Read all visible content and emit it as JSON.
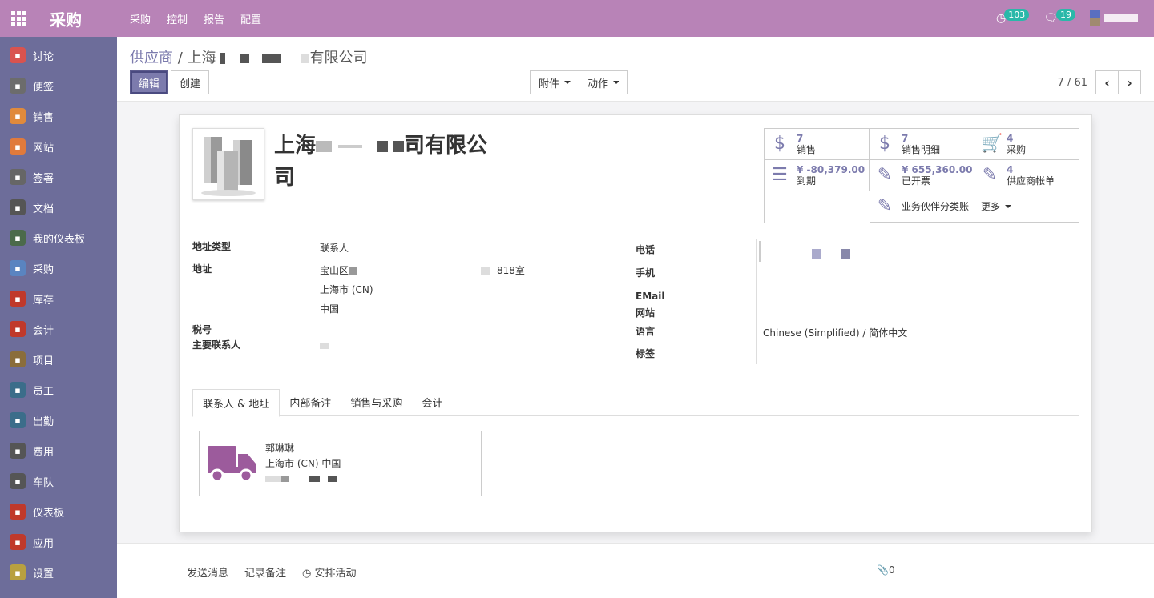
{
  "topbar": {
    "app_title": "采购",
    "menu": [
      "采购",
      "控制",
      "报告",
      "配置"
    ],
    "activity_count": "103",
    "message_count": "19"
  },
  "sidebar": {
    "items": [
      {
        "label": "讨论",
        "icon": "chat-icon",
        "color": "#d9534f"
      },
      {
        "label": "便签",
        "icon": "note-icon",
        "color": "#6c6c6c"
      },
      {
        "label": "销售",
        "icon": "chart-icon",
        "color": "#e08a3c"
      },
      {
        "label": "网站",
        "icon": "globe-icon",
        "color": "#e07a3c"
      },
      {
        "label": "签署",
        "icon": "sign-icon",
        "color": "#666666"
      },
      {
        "label": "文档",
        "icon": "document-icon",
        "color": "#555555"
      },
      {
        "label": "我的仪表板",
        "icon": "dashboard-icon",
        "color": "#4b6a4b"
      },
      {
        "label": "采购",
        "icon": "purchase-icon",
        "color": "#5a84c0"
      },
      {
        "label": "库存",
        "icon": "inventory-icon",
        "color": "#c0392b"
      },
      {
        "label": "会计",
        "icon": "accounting-icon",
        "color": "#c0392b"
      },
      {
        "label": "项目",
        "icon": "project-icon",
        "color": "#8a6d3b"
      },
      {
        "label": "员工",
        "icon": "employees-icon",
        "color": "#3b6d8a"
      },
      {
        "label": "出勤",
        "icon": "attendance-icon",
        "color": "#3b6d8a"
      },
      {
        "label": "费用",
        "icon": "expense-icon",
        "color": "#555555"
      },
      {
        "label": "车队",
        "icon": "fleet-icon",
        "color": "#555555"
      },
      {
        "label": "仪表板",
        "icon": "dashboards-icon",
        "color": "#c0392b"
      },
      {
        "label": "应用",
        "icon": "apps-icon",
        "color": "#c0392b"
      },
      {
        "label": "设置",
        "icon": "settings-icon",
        "color": "#b8a040"
      }
    ]
  },
  "breadcrumb": {
    "parent": "供应商",
    "separator": " / ",
    "current_prefix": "上海",
    "current_suffix": "有限公司"
  },
  "buttons": {
    "edit": "编辑",
    "create": "创建",
    "attachments": "附件",
    "action": "动作"
  },
  "pager": {
    "value": "7 / 61"
  },
  "partner": {
    "name_prefix": "上海",
    "name_mid": "司有限公",
    "name_suffix": "司"
  },
  "smart_buttons": [
    {
      "icon": "dollar-icon",
      "value": "7",
      "label": "销售"
    },
    {
      "icon": "dollar-icon",
      "value": "7",
      "label": "销售明细"
    },
    {
      "icon": "cart-icon",
      "value": "4",
      "label": "采购"
    },
    {
      "icon": "list-icon",
      "value": "¥ -80,379.00",
      "label": "到期"
    },
    {
      "icon": "edit-icon",
      "value": "¥ 655,360.00",
      "label": "已开票"
    },
    {
      "icon": "edit-icon",
      "value": "4",
      "label": "供应商帐单"
    },
    {
      "icon": "edit-icon",
      "value": "",
      "label": "业务伙伴分类账"
    },
    {
      "icon": "",
      "value": "",
      "label": "更多"
    }
  ],
  "fields": {
    "address_type_label": "地址类型",
    "address_type_value": "联系人",
    "address_label": "地址",
    "street": "宝山区",
    "room": "818室",
    "city": "上海市 (CN)",
    "country": "中国",
    "vat_label": "税号",
    "main_contact_label": "主要联系人",
    "phone_label": "电话",
    "mobile_label": "手机",
    "email_label": "EMail",
    "website_label": "网站",
    "lang_label": "语言",
    "lang_value": "Chinese (Simplified) / 简体中文",
    "tags_label": "标签"
  },
  "tabs": [
    "联系人 & 地址",
    "内部备注",
    "销售与采购",
    "会计"
  ],
  "contact": {
    "name": "郭琳琳",
    "address": "上海市 (CN) 中国"
  },
  "chatter": {
    "send_message": "发送消息",
    "log_note": "记录备注",
    "schedule": "安排活动",
    "followers": "0"
  },
  "colors": {
    "topbar": "#b883b7",
    "sidebar": "#6d6d9a",
    "accent": "#7c7bad",
    "truck": "#9c5b9c"
  }
}
